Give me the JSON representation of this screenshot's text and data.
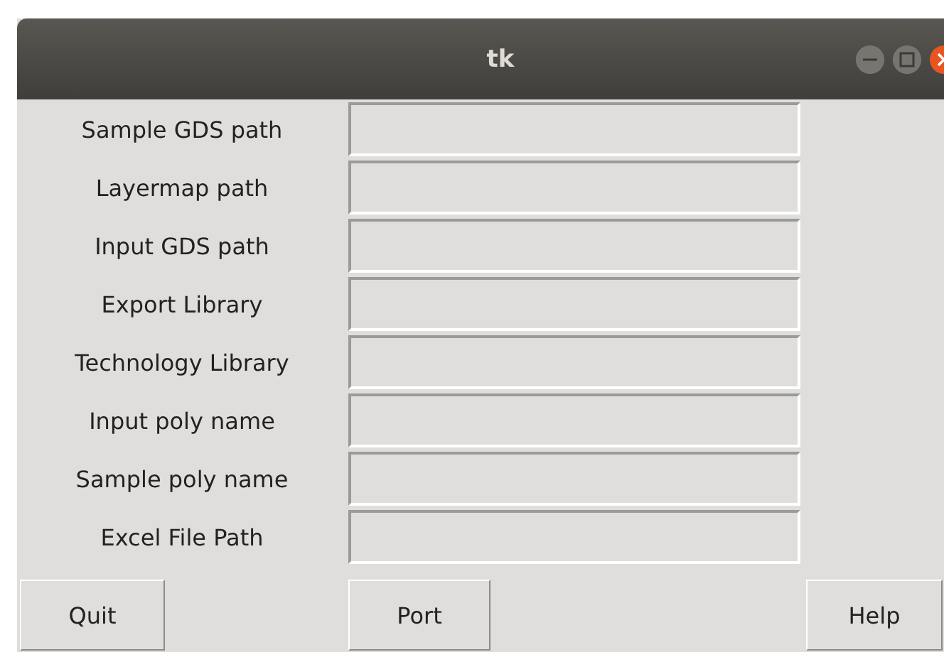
{
  "window": {
    "title": "tk"
  },
  "fields": [
    {
      "label": "Sample GDS path"
    },
    {
      "label": "Layermap path"
    },
    {
      "label": "Input GDS path"
    },
    {
      "label": "Export Library"
    },
    {
      "label": "Technology Library"
    },
    {
      "label": "Input poly name"
    },
    {
      "label": "Sample poly name"
    },
    {
      "label": "Excel File Path"
    }
  ],
  "buttons": [
    "Quit",
    "Port",
    "Help"
  ]
}
